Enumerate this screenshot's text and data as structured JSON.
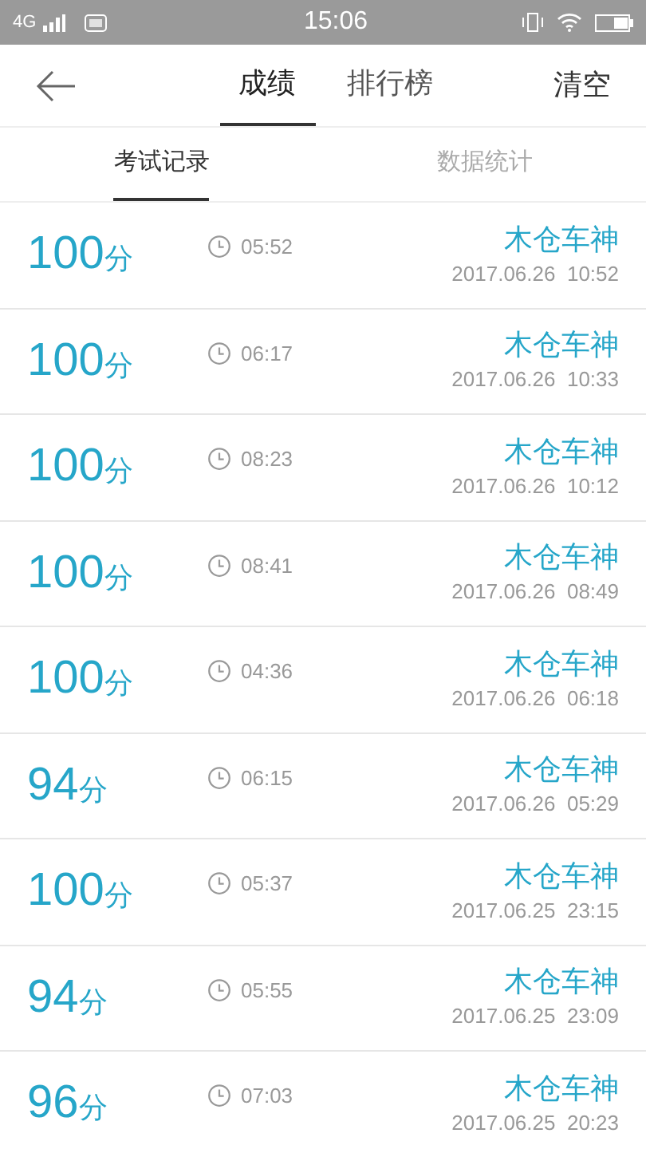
{
  "status_bar": {
    "network": "4G",
    "time": "15:06"
  },
  "header": {
    "tabs": [
      {
        "label": "成绩",
        "selected": true
      },
      {
        "label": "排行榜",
        "selected": false
      }
    ],
    "action": "清空"
  },
  "sub_tabs": [
    {
      "label": "考试记录",
      "selected": true
    },
    {
      "label": "数据统计",
      "selected": false
    }
  ],
  "records": [
    {
      "score": "100",
      "unit": "分",
      "duration": "05:52",
      "name": "木仓车神",
      "datetime": "2017.06.26  10:52"
    },
    {
      "score": "100",
      "unit": "分",
      "duration": "06:17",
      "name": "木仓车神",
      "datetime": "2017.06.26  10:33"
    },
    {
      "score": "100",
      "unit": "分",
      "duration": "08:23",
      "name": "木仓车神",
      "datetime": "2017.06.26  10:12"
    },
    {
      "score": "100",
      "unit": "分",
      "duration": "08:41",
      "name": "木仓车神",
      "datetime": "2017.06.26  08:49"
    },
    {
      "score": "100",
      "unit": "分",
      "duration": "04:36",
      "name": "木仓车神",
      "datetime": "2017.06.26  06:18"
    },
    {
      "score": "94",
      "unit": "分",
      "duration": "06:15",
      "name": "木仓车神",
      "datetime": "2017.06.26  05:29"
    },
    {
      "score": "100",
      "unit": "分",
      "duration": "05:37",
      "name": "木仓车神",
      "datetime": "2017.06.25  23:15"
    },
    {
      "score": "94",
      "unit": "分",
      "duration": "05:55",
      "name": "木仓车神",
      "datetime": "2017.06.25  23:09"
    },
    {
      "score": "96",
      "unit": "分",
      "duration": "07:03",
      "name": "木仓车神",
      "datetime": "2017.06.25  20:23"
    }
  ]
}
